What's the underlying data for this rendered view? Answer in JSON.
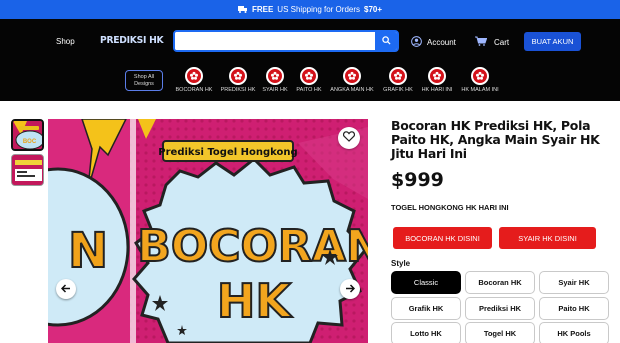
{
  "topbar": {
    "free": "FREE",
    "text": "US Shipping for Orders",
    "amount": "$70+"
  },
  "header": {
    "shop_label": "Shop",
    "logo_text": "PREDIKSI HK",
    "search_placeholder": "",
    "account_label": "Account",
    "cart_label": "Cart",
    "cta_label": "BUAT AKUN",
    "accent_color": "#1d6af2"
  },
  "categories": {
    "all_label_line1": "Shop All",
    "all_label_line2": "Designs",
    "items": [
      {
        "label": "BOCORAN HK"
      },
      {
        "label": "PREDIKSI HK"
      },
      {
        "label": "SYAIR HK"
      },
      {
        "label": "PAITO HK"
      },
      {
        "label": "ANGKA MAIN HK"
      },
      {
        "label": "GRAFIK HK"
      },
      {
        "label": "HK HARI INI"
      },
      {
        "label": "HK MALAM INI"
      }
    ]
  },
  "hero": {
    "banner": "Prediksi Togel Hongkong",
    "big_line1": "BOCORAN",
    "big_line2": "HK",
    "side_letter": "N"
  },
  "product": {
    "title": "Bocoran HK  Prediksi HK, Pola Paito HK, Angka Main Syair HK Jitu Hari Ini",
    "price": "$999",
    "tagline": "TOGEL HONGKONG HK HARI INI",
    "btn_bocoran": "BOCORAN HK DISINI",
    "btn_syair": "SYAIR HK DISINI",
    "style_label": "Style",
    "options": [
      "Classic",
      "Bocoran HK",
      "Syair HK",
      "Grafik HK",
      "Prediksi HK",
      "Paito HK",
      "Lotto HK",
      "Togel HK",
      "HK Pools"
    ]
  }
}
